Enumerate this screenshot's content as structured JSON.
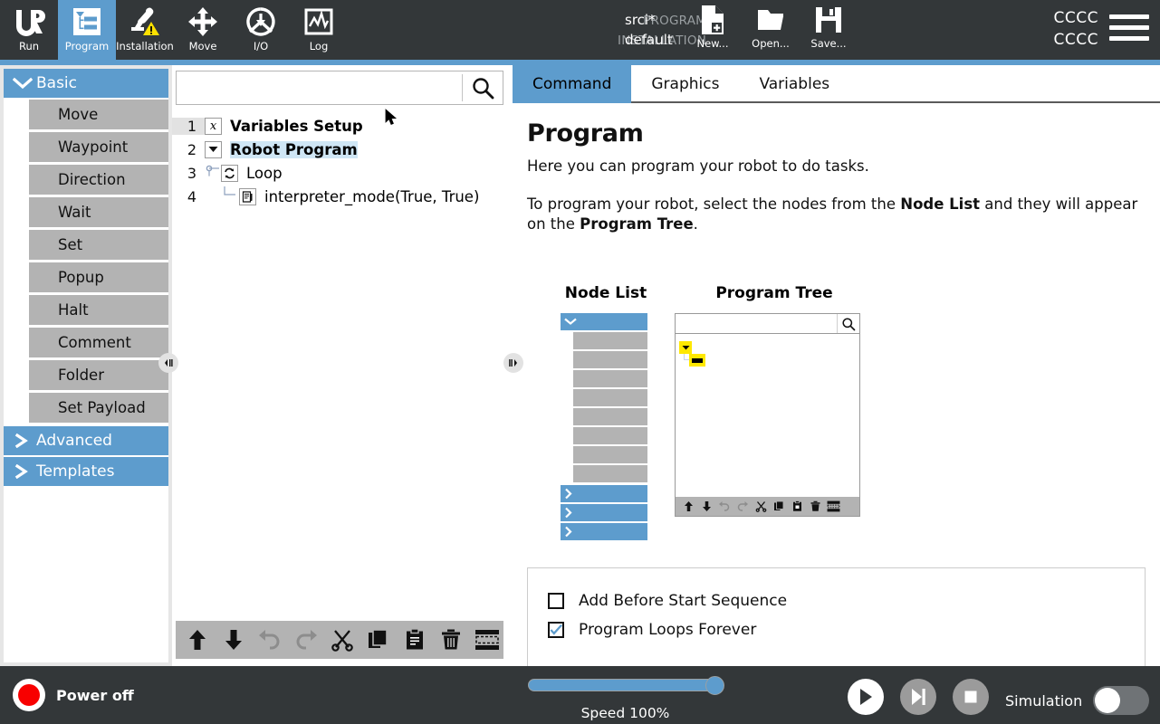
{
  "header": {
    "nav": [
      {
        "id": "run",
        "label": "Run",
        "icon": "ur-logo-icon",
        "active": false
      },
      {
        "id": "program",
        "label": "Program",
        "icon": "program-tree-icon",
        "active": true
      },
      {
        "id": "installation",
        "label": "Installation",
        "icon": "robot-arm-warning-icon",
        "active": false
      },
      {
        "id": "move",
        "label": "Move",
        "icon": "move-arrows-icon",
        "active": false
      },
      {
        "id": "io",
        "label": "I/O",
        "icon": "io-dial-icon",
        "active": false
      },
      {
        "id": "log",
        "label": "Log",
        "icon": "log-waveform-icon",
        "active": false
      }
    ],
    "meta": [
      {
        "key": "PROGRAM",
        "value": "srci*"
      },
      {
        "key": "INSTALLATION",
        "value": "default"
      }
    ],
    "file_actions": [
      {
        "id": "new",
        "label": "New...",
        "icon": "new-file-icon"
      },
      {
        "id": "open",
        "label": "Open...",
        "icon": "open-folder-icon"
      },
      {
        "id": "save",
        "label": "Save...",
        "icon": "save-floppy-icon"
      }
    ],
    "account_line1": "CCCC",
    "account_line2": "CCCC",
    "menu_icon": "hamburger-menu-icon"
  },
  "sidebar": {
    "groups": [
      {
        "id": "basic",
        "label": "Basic",
        "expanded": true,
        "chevron": "chevron-down-icon",
        "items": [
          "Move",
          "Waypoint",
          "Direction",
          "Wait",
          "Set",
          "Popup",
          "Halt",
          "Comment",
          "Folder",
          "Set Payload"
        ]
      },
      {
        "id": "advanced",
        "label": "Advanced",
        "expanded": false,
        "chevron": "chevron-right-icon",
        "items": []
      },
      {
        "id": "templates",
        "label": "Templates",
        "expanded": false,
        "chevron": "chevron-right-icon",
        "items": []
      }
    ]
  },
  "program_tree": {
    "search": {
      "value": "",
      "placeholder": "",
      "icon": "search-icon"
    },
    "rows": [
      {
        "num": "1",
        "icon": "variables-x-icon",
        "icon_glyph": "𝑥",
        "text": "Variables Setup",
        "bold": true,
        "indent": 0,
        "selected_num": true,
        "highlighted": false
      },
      {
        "num": "2",
        "icon": "collapse-triangle-icon",
        "icon_glyph": "▼",
        "text": "Robot Program",
        "bold": true,
        "indent": 0,
        "selected_num": false,
        "highlighted": true
      },
      {
        "num": "3",
        "icon": "loop-icon",
        "icon_glyph": "↻",
        "text": "Loop",
        "bold": false,
        "indent": 1,
        "selected_num": false,
        "highlighted": false
      },
      {
        "num": "4",
        "icon": "script-icon",
        "icon_glyph": "▤",
        "text": "interpreter_mode(True, True)",
        "bold": false,
        "indent": 2,
        "selected_num": false,
        "highlighted": false
      }
    ],
    "toolbar": [
      {
        "id": "move-up",
        "icon": "arrow-up-icon"
      },
      {
        "id": "move-down",
        "icon": "arrow-down-icon"
      },
      {
        "id": "undo",
        "icon": "undo-icon"
      },
      {
        "id": "redo",
        "icon": "redo-icon"
      },
      {
        "id": "cut",
        "icon": "scissors-icon"
      },
      {
        "id": "copy",
        "icon": "copy-icon"
      },
      {
        "id": "paste",
        "icon": "clipboard-paste-icon"
      },
      {
        "id": "delete",
        "icon": "trash-icon"
      },
      {
        "id": "suppress",
        "icon": "suppress-icon"
      }
    ]
  },
  "right_panel": {
    "tabs": [
      {
        "id": "command",
        "label": "Command",
        "active": true
      },
      {
        "id": "graphics",
        "label": "Graphics",
        "active": false
      },
      {
        "id": "variables",
        "label": "Variables",
        "active": false
      }
    ],
    "title": "Program",
    "paragraph1": "Here you can program your robot to do tasks.",
    "paragraph2_parts": {
      "a": "To program your robot, select the nodes from the ",
      "b": "Node List",
      "c": " and they will appear on the ",
      "d": "Program Tree",
      "e": "."
    },
    "illustration": {
      "node_list_title": "Node List",
      "program_tree_title": "Program Tree",
      "search_icon": "search-icon",
      "toolbar": [
        {
          "id": "move-up",
          "icon": "arrow-up-icon"
        },
        {
          "id": "move-down",
          "icon": "arrow-down-icon"
        },
        {
          "id": "undo",
          "icon": "undo-icon"
        },
        {
          "id": "redo",
          "icon": "redo-icon"
        },
        {
          "id": "cut",
          "icon": "scissors-icon"
        },
        {
          "id": "copy",
          "icon": "copy-icon"
        },
        {
          "id": "paste",
          "icon": "clipboard-paste-icon"
        },
        {
          "id": "delete",
          "icon": "trash-icon"
        },
        {
          "id": "suppress",
          "icon": "suppress-icon"
        }
      ]
    },
    "options": [
      {
        "id": "add-before-start",
        "label": "Add Before Start Sequence",
        "checked": false
      },
      {
        "id": "program-loops-forever",
        "label": "Program Loops Forever",
        "checked": true
      }
    ]
  },
  "footer": {
    "power_label": "Power off",
    "power_state_color": "#f80000",
    "speed_label": "Speed 100%",
    "speed_percent": 100,
    "transport": [
      {
        "id": "play",
        "icon": "play-icon"
      },
      {
        "id": "step",
        "icon": "step-icon"
      },
      {
        "id": "stop",
        "icon": "stop-icon"
      }
    ],
    "simulation_label": "Simulation",
    "simulation_on": false
  },
  "colors": {
    "accent": "#5d9ccd",
    "dark": "#333739",
    "node_gray": "#b3b3b3",
    "highlight": "#cfe6f5",
    "yellow": "#ffe800",
    "red": "#f80000"
  }
}
